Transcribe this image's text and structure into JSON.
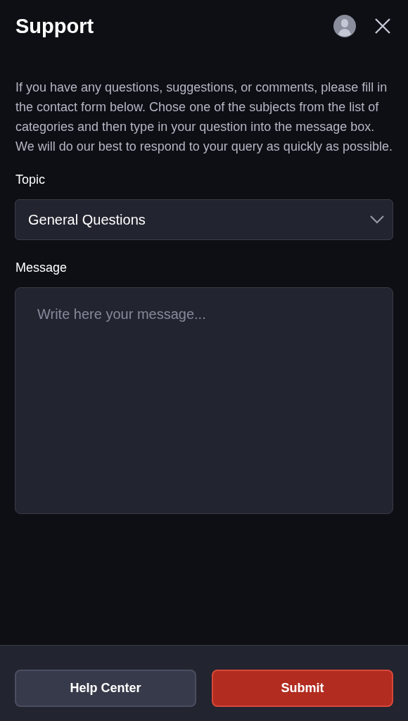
{
  "header": {
    "title": "Support"
  },
  "intro": "If you have any questions, suggestions, or comments, please fill in the contact form below. Chose one of the subjects from the list of categories and then type in your question into the message box. We will do our best to respond to your query as quickly as possible.",
  "topic": {
    "label": "Topic",
    "value": "General Questions"
  },
  "message": {
    "label": "Message",
    "placeholder": "Write here your message..."
  },
  "buttons": [
    {
      "label": "Help Center",
      "kind": "secondary"
    },
    {
      "label": "Submit",
      "kind": "primary"
    }
  ]
}
